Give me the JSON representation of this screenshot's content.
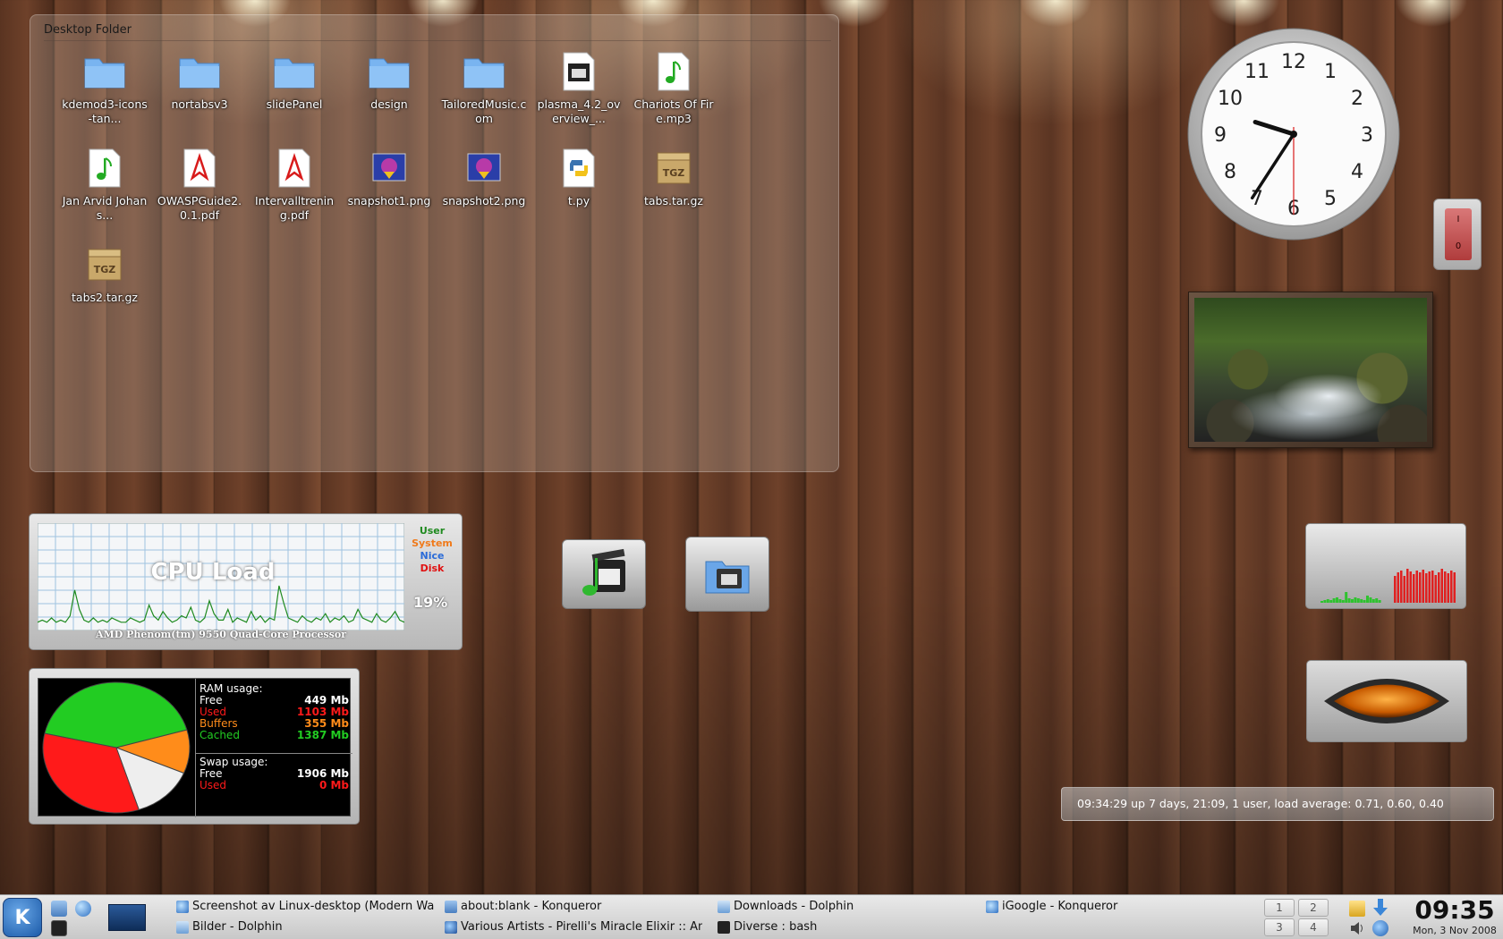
{
  "folder_view": {
    "title": "Desktop Folder",
    "items": [
      {
        "label": "kdemod3-icons-tan...",
        "icon": "folder-icon"
      },
      {
        "label": "nortabsv3",
        "icon": "folder-icon"
      },
      {
        "label": "slidePanel",
        "icon": "folder-icon"
      },
      {
        "label": "design",
        "icon": "folder-icon"
      },
      {
        "label": "TailoredMusic.com",
        "icon": "folder-icon"
      },
      {
        "label": "plasma_4.2_overview_...",
        "icon": "video-file-icon"
      },
      {
        "label": "Chariots Of Fire.mp3",
        "icon": "audio-file-icon"
      },
      {
        "label": "Jan Arvid Johans...",
        "icon": "audio-file-icon"
      },
      {
        "label": "OWASPGuide2.0.1.pdf",
        "icon": "pdf-file-icon"
      },
      {
        "label": "Intervalltrening.pdf",
        "icon": "pdf-file-icon"
      },
      {
        "label": "snapshot1.png",
        "icon": "image-file-icon"
      },
      {
        "label": "snapshot2.png",
        "icon": "image-file-icon"
      },
      {
        "label": "t.py",
        "icon": "python-file-icon"
      },
      {
        "label": "tabs.tar.gz",
        "icon": "archive-file-icon"
      },
      {
        "label": "tabs2.tar.gz",
        "icon": "archive-file-icon"
      }
    ]
  },
  "analog_clock": {
    "hour": 9,
    "minute": 35,
    "second": 30
  },
  "switch_widget": {
    "top_label": "I",
    "bottom_label": "0"
  },
  "cpu_widget": {
    "title": "CPU Load",
    "legend": [
      {
        "label": "User",
        "color": "#1f8a1f"
      },
      {
        "label": "System",
        "color": "#f07a1a"
      },
      {
        "label": "Nice",
        "color": "#2a6bd8"
      },
      {
        "label": "Disk",
        "color": "#e01010"
      }
    ],
    "percent": "19%",
    "processor": "AMD Phenom(tm) 9550 Quad-Core Processor",
    "load_series": [
      3,
      4,
      3,
      5,
      3,
      4,
      3,
      6,
      18,
      9,
      4,
      3,
      5,
      3,
      4,
      3,
      5,
      4,
      3,
      3,
      5,
      4,
      3,
      4,
      11,
      6,
      4,
      8,
      5,
      3,
      4,
      6,
      5,
      10,
      4,
      3,
      5,
      13,
      7,
      4,
      4,
      9,
      3,
      5,
      4,
      3,
      8,
      4,
      6,
      3,
      5,
      4,
      20,
      12,
      5,
      4,
      3,
      6,
      4,
      3,
      5,
      4,
      7,
      3,
      5,
      4,
      6,
      3,
      4,
      9,
      5,
      4,
      3,
      7,
      4,
      3,
      5,
      8,
      4,
      3
    ]
  },
  "ram_widget": {
    "ram_title": "RAM usage:",
    "ram": [
      {
        "label": "Free",
        "value": "449 Mb",
        "color": "#ffffff",
        "mb": 449
      },
      {
        "label": "Used",
        "value": "1103 Mb",
        "color": "#ff1a1a",
        "mb": 1103
      },
      {
        "label": "Buffers",
        "value": "355 Mb",
        "color": "#ff8c1a",
        "mb": 355
      },
      {
        "label": "Cached",
        "value": "1387 Mb",
        "color": "#22cc22",
        "mb": 1387
      }
    ],
    "swap_title": "Swap usage:",
    "swap": [
      {
        "label": "Free",
        "value": "1906 Mb",
        "color": "#ffffff"
      },
      {
        "label": "Used",
        "value": "0 Mb",
        "color": "#ff1a1a"
      }
    ]
  },
  "uptime": {
    "text": "09:34:29 up 7 days, 21:09,  1 user,  load average: 0.71, 0.60, 0.40"
  },
  "taskbar": {
    "tasks": [
      {
        "label": "Screenshot av Linux-desktop (Modern Wal",
        "icon": "konqueror-icon"
      },
      {
        "label": "about:blank - Konqueror",
        "icon": "folder-window-icon"
      },
      {
        "label": "Downloads - Dolphin",
        "icon": "dolphin-icon"
      },
      {
        "label": "iGoogle - Konqueror",
        "icon": "konqueror-icon"
      },
      {
        "label": "Bilder - Dolphin",
        "icon": "dolphin-icon"
      },
      {
        "label": "Various Artists - Pirelli's Miracle Elixir  ::  Am",
        "icon": "amarok-icon"
      },
      {
        "label": "Diverse : bash",
        "icon": "terminal-icon"
      }
    ],
    "desktops": [
      "1",
      "2",
      "3",
      "4"
    ],
    "clock_time": "09:35",
    "clock_date": "Mon, 3 Nov 2008"
  }
}
